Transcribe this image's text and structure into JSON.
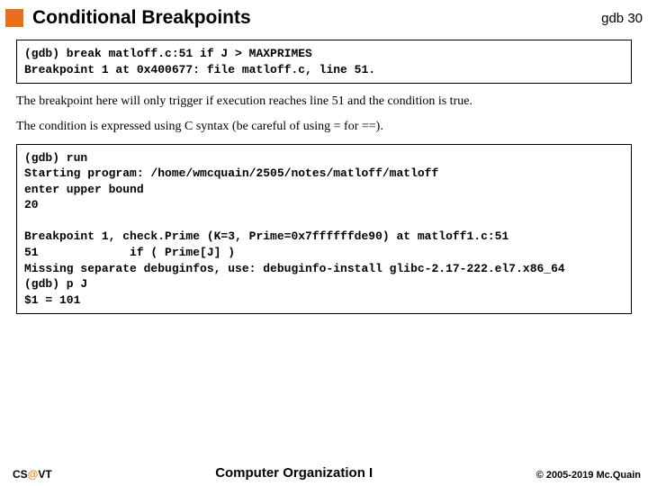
{
  "header": {
    "title": "Conditional Breakpoints",
    "course_tag": "gdb",
    "page_number": "30"
  },
  "code1_lines": [
    "(gdb) break matloff.c:51 if J > MAXPRIMES",
    "Breakpoint 1 at 0x400677: file matloff.c, line 51."
  ],
  "para1": "The breakpoint here will only trigger if execution reaches line 51 and the condition is true.",
  "para2": "The condition is expressed using C syntax (be careful of using = for ==).",
  "code2_lines": [
    "(gdb) run",
    "Starting program: /home/wmcquain/2505/notes/matloff/matloff",
    "enter upper bound",
    "20",
    "",
    "Breakpoint 1, check.Prime (K=3, Prime=0x7ffffffde90) at matloff1.c:51",
    "51             if ( Prime[J] )",
    "Missing separate debuginfos, use: debuginfo-install glibc-2.17-222.el7.x86_64",
    "(gdb) p J",
    "$1 = 101"
  ],
  "footer": {
    "left_prefix": "CS",
    "left_at": "@",
    "left_suffix": "VT",
    "center": "Computer Organization I",
    "right": "© 2005-2019 Mc.Quain"
  }
}
